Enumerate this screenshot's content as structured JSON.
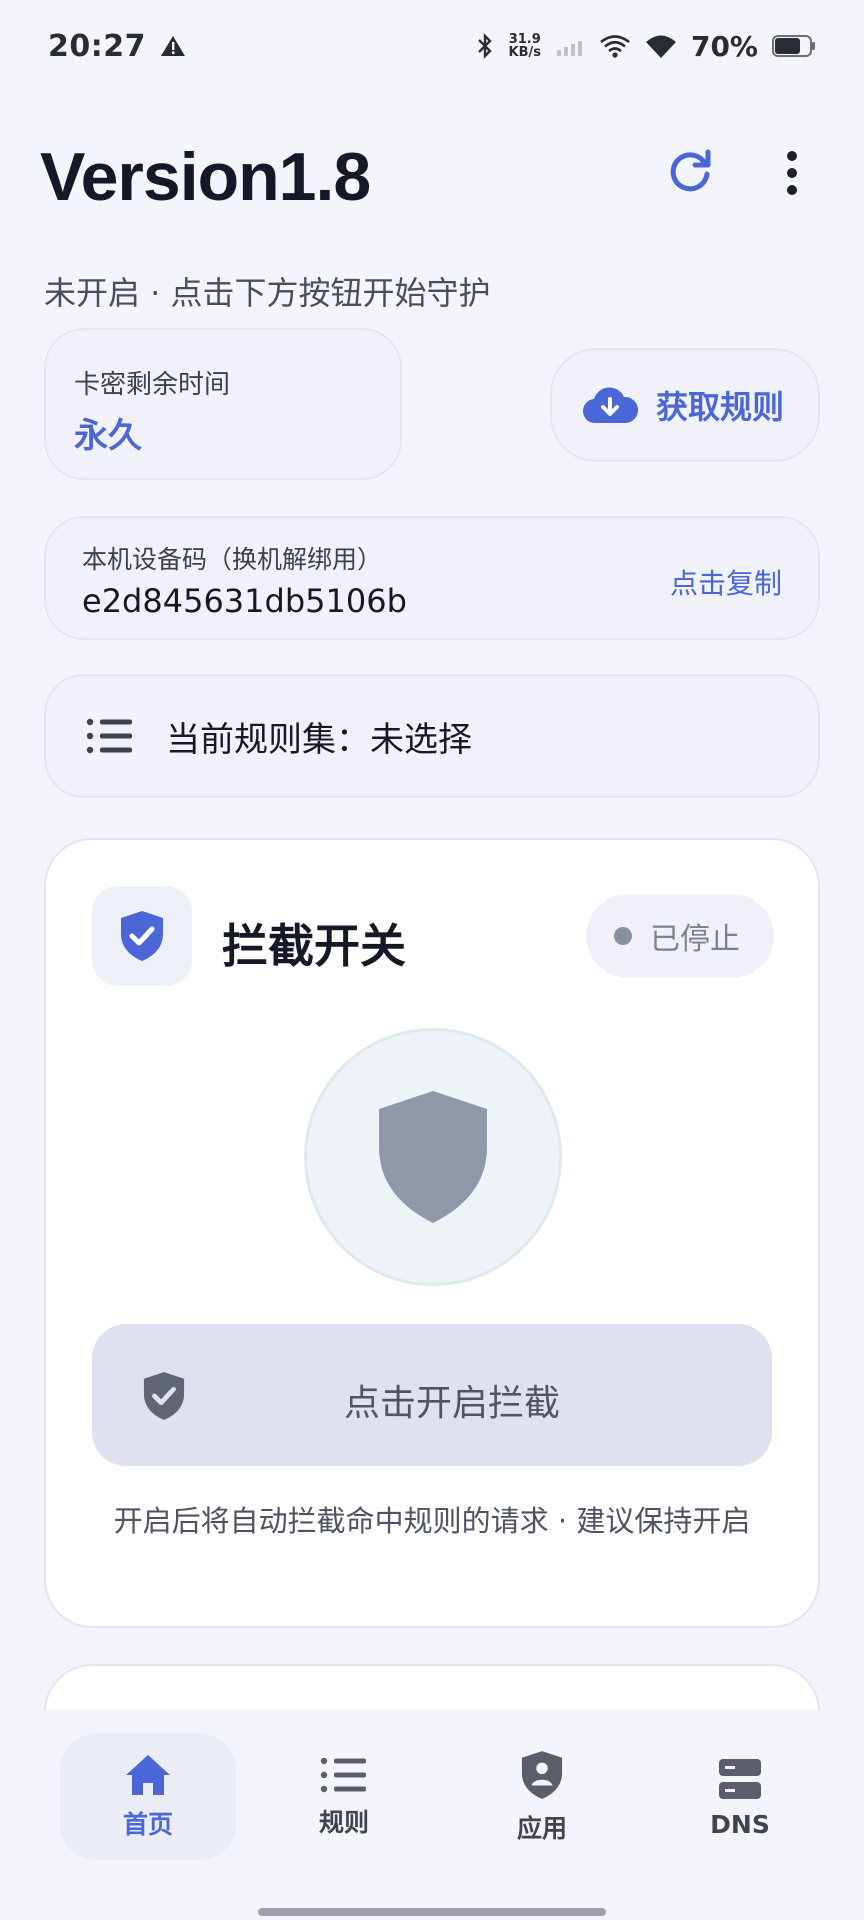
{
  "status_bar": {
    "time": "20:27",
    "net_speed_value": "31.9",
    "net_speed_unit": "KB/s",
    "battery_percent": "70%",
    "icons": [
      "warning-icon",
      "bluetooth-icon",
      "signal-icon",
      "wifi-icon",
      "battery-icon"
    ]
  },
  "header": {
    "title": "Version1.8",
    "subtitle": "未开启 · 点击下方按钮开始守护",
    "icons": [
      "refresh-icon",
      "more-vertical-icon"
    ]
  },
  "card_time": {
    "label": "卡密剩余时间",
    "value": "永久"
  },
  "fetch_rules_button": {
    "label": "获取规则",
    "icon": "cloud-download-icon"
  },
  "device": {
    "label": "本机设备码（换机解绑用）",
    "code": "e2d845631db5106b",
    "copy_label": "点击复制"
  },
  "ruleset": {
    "label": "当前规则集：未选择",
    "icon": "list-icon"
  },
  "intercept": {
    "title": "拦截开关",
    "status": "已停止",
    "button_label": "点击开启拦截",
    "hint": "开启后将自动拦截命中规则的请求 · 建议保持开启"
  },
  "bottom_nav": {
    "items": [
      {
        "label": "首页",
        "icon": "home-icon",
        "active": true
      },
      {
        "label": "规则",
        "icon": "list-icon",
        "active": false
      },
      {
        "label": "应用",
        "icon": "shield-user-icon",
        "active": false
      },
      {
        "label": "DNS",
        "icon": "server-icon",
        "active": false
      }
    ]
  },
  "colors": {
    "accent": "#4b66d6",
    "background": "#f4f5fb",
    "card": "#f1f1fa",
    "muted_shield": "#8f98ab"
  }
}
